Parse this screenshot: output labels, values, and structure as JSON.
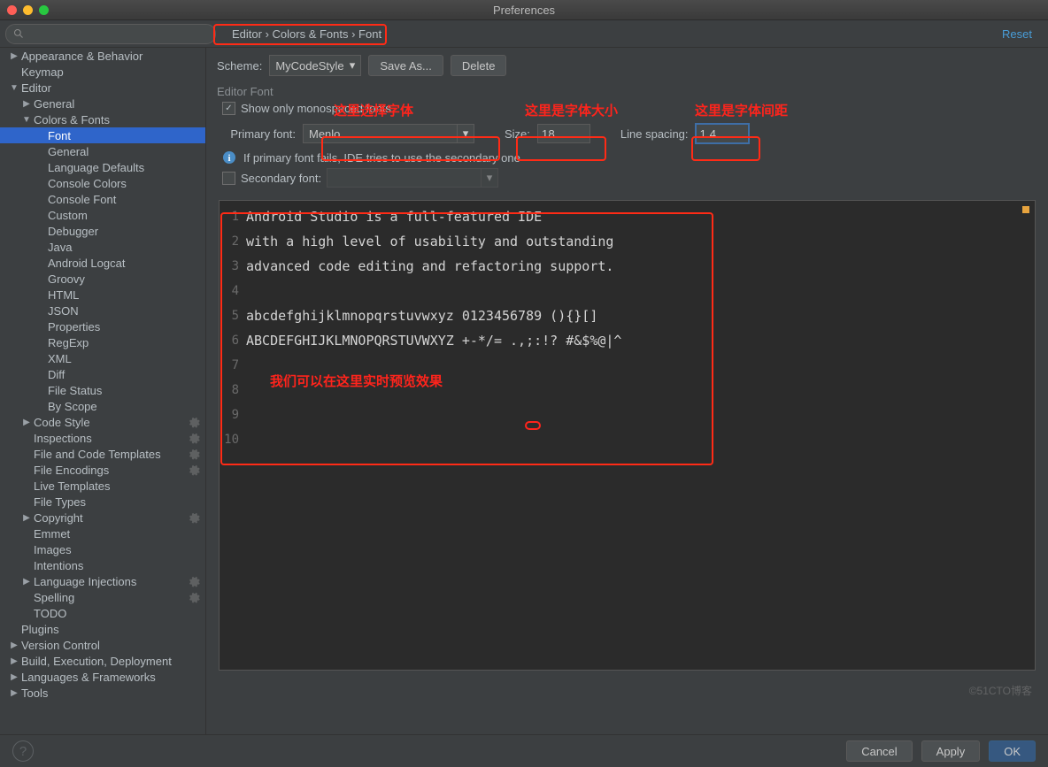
{
  "window": {
    "title": "Preferences"
  },
  "toolbar": {
    "breadcrumb": "Editor › Colors & Fonts › Font",
    "reset": "Reset"
  },
  "sidebar": {
    "items": [
      {
        "label": "Appearance & Behavior",
        "depth": 0,
        "arrow": "right"
      },
      {
        "label": "Keymap",
        "depth": 0
      },
      {
        "label": "Editor",
        "depth": 0,
        "arrow": "down"
      },
      {
        "label": "General",
        "depth": 1,
        "arrow": "right"
      },
      {
        "label": "Colors & Fonts",
        "depth": 1,
        "arrow": "down"
      },
      {
        "label": "Font",
        "depth": 2,
        "sel": true
      },
      {
        "label": "General",
        "depth": 2
      },
      {
        "label": "Language Defaults",
        "depth": 2
      },
      {
        "label": "Console Colors",
        "depth": 2
      },
      {
        "label": "Console Font",
        "depth": 2
      },
      {
        "label": "Custom",
        "depth": 2
      },
      {
        "label": "Debugger",
        "depth": 2
      },
      {
        "label": "Java",
        "depth": 2
      },
      {
        "label": "Android Logcat",
        "depth": 2
      },
      {
        "label": "Groovy",
        "depth": 2
      },
      {
        "label": "HTML",
        "depth": 2
      },
      {
        "label": "JSON",
        "depth": 2
      },
      {
        "label": "Properties",
        "depth": 2
      },
      {
        "label": "RegExp",
        "depth": 2
      },
      {
        "label": "XML",
        "depth": 2
      },
      {
        "label": "Diff",
        "depth": 2
      },
      {
        "label": "File Status",
        "depth": 2
      },
      {
        "label": "By Scope",
        "depth": 2
      },
      {
        "label": "Code Style",
        "depth": 1,
        "arrow": "right",
        "gear": true
      },
      {
        "label": "Inspections",
        "depth": 1,
        "gear": true
      },
      {
        "label": "File and Code Templates",
        "depth": 1,
        "gear": true
      },
      {
        "label": "File Encodings",
        "depth": 1,
        "gear": true
      },
      {
        "label": "Live Templates",
        "depth": 1
      },
      {
        "label": "File Types",
        "depth": 1
      },
      {
        "label": "Copyright",
        "depth": 1,
        "arrow": "right",
        "gear": true
      },
      {
        "label": "Emmet",
        "depth": 1
      },
      {
        "label": "Images",
        "depth": 1
      },
      {
        "label": "Intentions",
        "depth": 1
      },
      {
        "label": "Language Injections",
        "depth": 1,
        "arrow": "right",
        "gear": true
      },
      {
        "label": "Spelling",
        "depth": 1,
        "gear": true
      },
      {
        "label": "TODO",
        "depth": 1
      },
      {
        "label": "Plugins",
        "depth": 0
      },
      {
        "label": "Version Control",
        "depth": 0,
        "arrow": "right"
      },
      {
        "label": "Build, Execution, Deployment",
        "depth": 0,
        "arrow": "right"
      },
      {
        "label": "Languages & Frameworks",
        "depth": 0,
        "arrow": "right"
      },
      {
        "label": "Tools",
        "depth": 0,
        "arrow": "right"
      }
    ]
  },
  "scheme": {
    "label": "Scheme:",
    "value": "MyCodeStyle",
    "save_as": "Save As...",
    "delete": "Delete"
  },
  "editor_font": {
    "section": "Editor Font",
    "show_mono": "Show only monospaced fonts",
    "show_mono_checked": true,
    "primary_label": "Primary font:",
    "primary_value": "Menlo",
    "size_label": "Size:",
    "size_value": "18",
    "spacing_label": "Line spacing:",
    "spacing_value": "1.4",
    "fallback": "If primary font fails, IDE tries to use the secondary one",
    "secondary_label": "Secondary font:",
    "secondary_checked": false
  },
  "preview": {
    "lines": [
      "Android Studio is a full-featured IDE",
      "with a high level of usability and outstanding",
      "advanced code editing and refactoring support.",
      "",
      "abcdefghijklmnopqrstuvwxyz 0123456789 (){}[]",
      "ABCDEFGHIJKLMNOPQRSTUVWXYZ +-*/= .,;:!? #&$%@|^",
      "",
      "",
      "",
      ""
    ]
  },
  "annotations": {
    "font": "这里选择字体",
    "size": "这里是字体大小",
    "spacing": "这里是字体间距",
    "preview": "我们可以在这里实时预览效果"
  },
  "footer": {
    "cancel": "Cancel",
    "apply": "Apply",
    "ok": "OK"
  },
  "watermark": "©51CTO博客"
}
